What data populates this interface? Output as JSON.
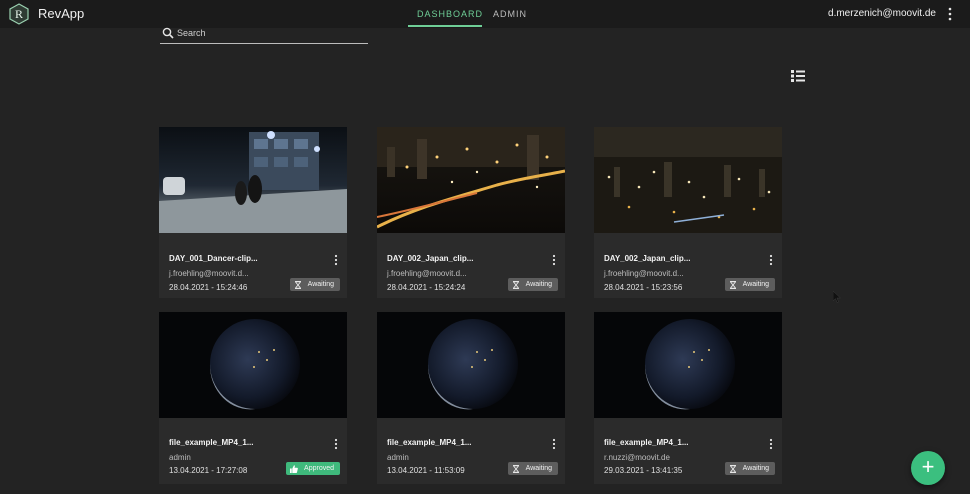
{
  "header": {
    "app_title": "RevApp",
    "logo_letter": "R",
    "tabs": [
      {
        "label": "DASHBOARD",
        "active": true
      },
      {
        "label": "ADMIN",
        "active": false
      }
    ],
    "user_email": "d.merzenich@moovit.de",
    "menu_icon": "more-vertical-icon"
  },
  "search": {
    "placeholder": "Search",
    "value": "",
    "icon": "search-icon"
  },
  "view_toggle_icon": "list-view-icon",
  "cards": [
    {
      "title": "DAY_001_Dancer-clip...",
      "owner": "j.froehling@moovit.d...",
      "date": "28.04.2021 - 15:24:46",
      "status": "Awaiting",
      "thumbnail": "street-night-dancers"
    },
    {
      "title": "DAY_002_Japan_clip...",
      "owner": "j.froehling@moovit.d...",
      "date": "28.04.2021 - 15:24:24",
      "status": "Awaiting",
      "thumbnail": "city-night-river"
    },
    {
      "title": "DAY_002_Japan_clip...",
      "owner": "j.froehling@moovit.d...",
      "date": "28.04.2021 - 15:23:56",
      "status": "Awaiting",
      "thumbnail": "city-night-skyline"
    },
    {
      "title": "file_example_MP4_1...",
      "owner": "admin",
      "date": "13.04.2021 - 17:27:08",
      "status": "Approved",
      "thumbnail": "earth-night"
    },
    {
      "title": "file_example_MP4_1...",
      "owner": "admin",
      "date": "13.04.2021 - 11:53:09",
      "status": "Awaiting",
      "thumbnail": "earth-night"
    },
    {
      "title": "file_example_MP4_1...",
      "owner": "r.nuzzi@moovit.de",
      "date": "29.03.2021 - 13:41:35",
      "status": "Awaiting",
      "thumbnail": "earth-night"
    }
  ],
  "fab": {
    "label": "+",
    "icon": "add-icon"
  },
  "colors": {
    "accent": "#6fcf97",
    "approved": "#3fb97c",
    "awaiting": "#5d5d5d",
    "background": "#232323",
    "card": "#2b2b2b"
  }
}
